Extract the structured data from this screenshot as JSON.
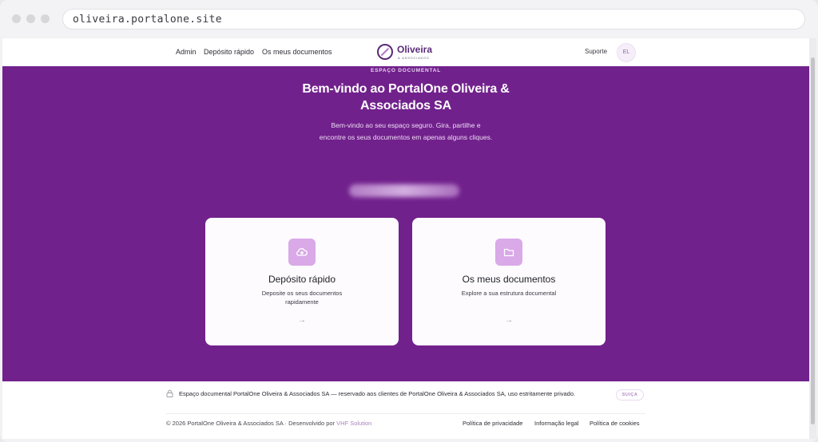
{
  "browser": {
    "url": "oliveira.portalone.site"
  },
  "header": {
    "nav": [
      "Admin",
      "Depósito rápido",
      "Os meus documentos"
    ],
    "logo": {
      "name": "Oliveira",
      "sub": "& Associados"
    },
    "support": "Suporte",
    "avatar_initials": "EL"
  },
  "hero": {
    "eyebrow": "ESPAÇO DOCUMENTAL",
    "title": "Bem-vindo ao PortalOne Oliveira & Associados SA",
    "subtitle": "Bem-vindo ao seu espaço seguro. Gira, partilhe e encontre os seus documentos em apenas alguns cliques."
  },
  "cards": [
    {
      "title": "Depósito rápido",
      "description": "Deposite os seus documentos rapidamente",
      "icon": "cloud-upload-icon"
    },
    {
      "title": "Os meus documentos",
      "description": "Explore a sua estrutura documental",
      "icon": "folder-icon"
    }
  ],
  "footer": {
    "notice": "Espaço documental PortalOne Oliveira & Associados SA — reservado aos clientes de PortalOne Oliveira & Associados SA, uso estritamente privado.",
    "badge": "SUIÇA",
    "copyright_prefix": "© 2026 PortalOne Oliveira & Associados SA · Desenvolvido por",
    "developer": "VHF Solution",
    "links": [
      "Política de privacidade",
      "Informação legal",
      "Política de cookies"
    ]
  },
  "colors": {
    "brand_purple": "#71218c",
    "icon_bg": "#d9a9e8",
    "card_bg": "#fdfbfe"
  }
}
